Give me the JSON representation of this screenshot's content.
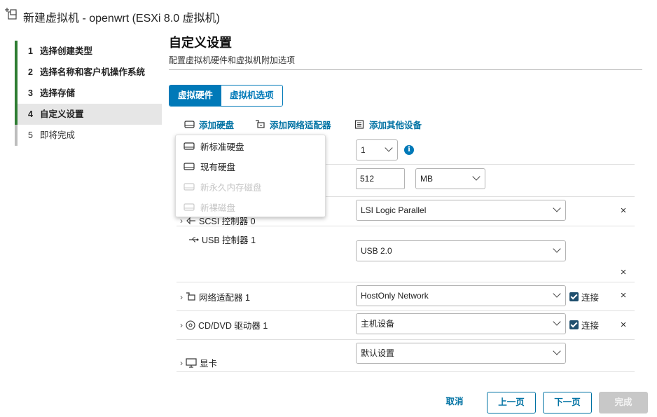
{
  "window": {
    "title": "新建虚拟机 - openwrt (ESXi 8.0 虚拟机)"
  },
  "steps": [
    {
      "num": "1",
      "label": "选择创建类型",
      "state": "done"
    },
    {
      "num": "2",
      "label": "选择名称和客户机操作系统",
      "state": "done"
    },
    {
      "num": "3",
      "label": "选择存储",
      "state": "done"
    },
    {
      "num": "4",
      "label": "自定义设置",
      "state": "active"
    },
    {
      "num": "5",
      "label": "即将完成",
      "state": "pending"
    }
  ],
  "page": {
    "title": "自定义设置",
    "subtitle": "配置虚拟机硬件和虚拟机附加选项"
  },
  "tabs": {
    "hardware": "虚拟硬件",
    "options": "虚拟机选项"
  },
  "toolbar": {
    "add_disk": "添加硬盘",
    "add_nic": "添加网络适配器",
    "add_other": "添加其他设备"
  },
  "menu": {
    "items": [
      {
        "label": "新标准硬盘",
        "enabled": true
      },
      {
        "label": "现有硬盘",
        "enabled": true
      },
      {
        "label": "新永久内存磁盘",
        "enabled": false
      },
      {
        "label": "新裸磁盘",
        "enabled": false
      }
    ]
  },
  "rows": {
    "cpu": {
      "value": "1"
    },
    "memory": {
      "value": "512",
      "unit": "MB"
    },
    "scsi": {
      "label": "SCSI 控制器 0",
      "value": "LSI Logic Parallel"
    },
    "usb": {
      "label": "USB 控制器 1",
      "value": "USB 2.0"
    },
    "nic": {
      "label": "网络适配器 1",
      "value": "HostOnly Network",
      "connect": "连接"
    },
    "cdrom": {
      "label": "CD/DVD 驱动器 1",
      "value": "主机设备",
      "connect": "连接"
    },
    "video": {
      "label": "显卡",
      "value": "默认设置"
    }
  },
  "footer": {
    "cancel": "取消",
    "back": "上一页",
    "next": "下一页",
    "finish": "完成"
  },
  "colors": {
    "accent": "#0079b8",
    "step_done": "#2e7d32",
    "checkbox": "#1f4f6e",
    "disabled": "#c8c8c8"
  }
}
